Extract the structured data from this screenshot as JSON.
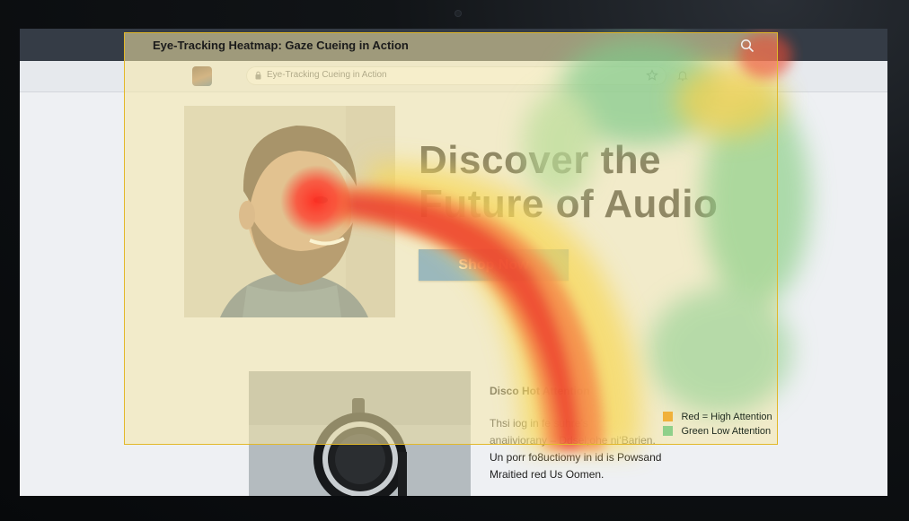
{
  "overlay": {
    "title": "Eye-Tracking Heatmap: Gaze Cueing in Action"
  },
  "browser": {
    "url_text": "Eye-Tracking Cueing in Action"
  },
  "hero": {
    "headline_line1": "Discover the",
    "headline_line2": "Future of Audio",
    "cta_label": "Shop Now"
  },
  "section": {
    "heading": "Disco Hot Attention",
    "lines": [
      "Thsi iog in fe suhre’s",
      "anaiiviorany – Ddsel;ohe ni‘Barien.",
      "Un porr fo8uctiomy in id is Powsand",
      "Mraitied red Us Oomen."
    ]
  },
  "legend": {
    "high_label": "Red = High Attention",
    "low_label": "Green Low Attention",
    "high_color": "#f0b13a",
    "low_color": "#8fd08a"
  },
  "colors": {
    "cta": "#2d7ed6",
    "overlay_border": "#e2b829",
    "heat_high": "#ee3b2b",
    "heat_mid": "#f7d85a",
    "heat_low": "#7fca8a"
  },
  "icons": [
    "search-icon",
    "lock-icon",
    "star-icon",
    "bell-icon"
  ]
}
